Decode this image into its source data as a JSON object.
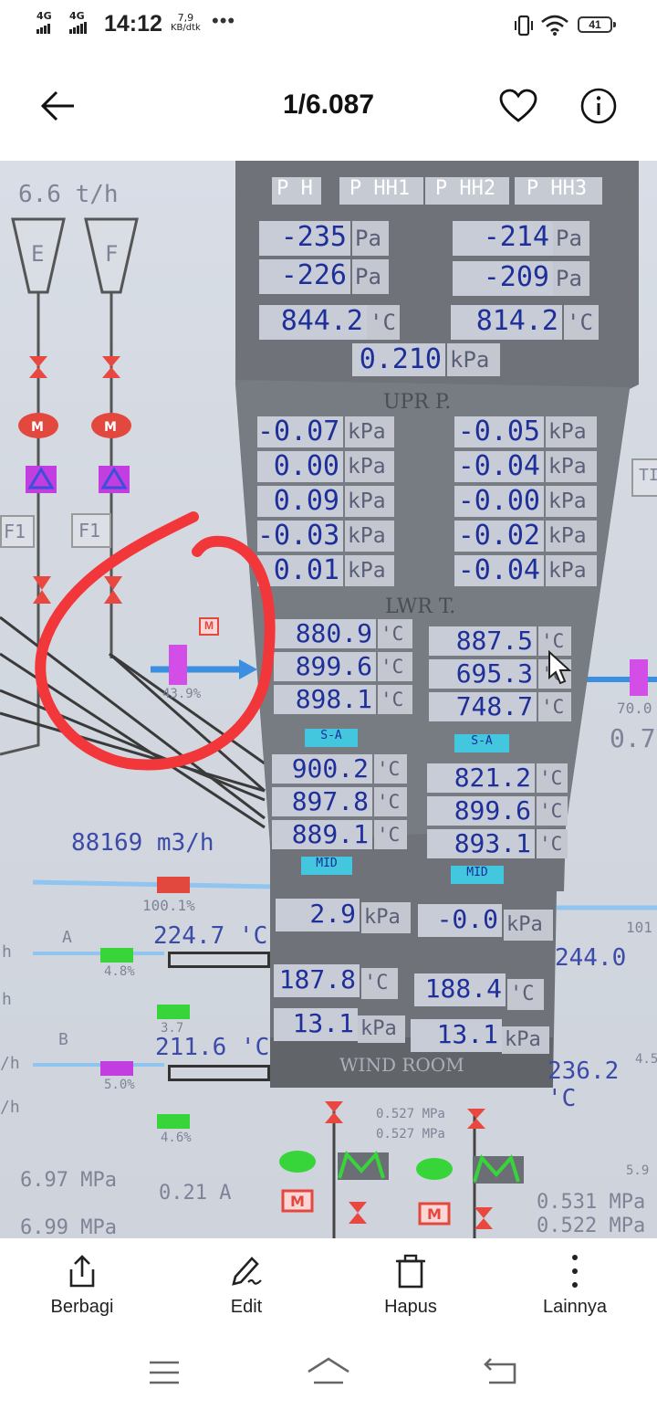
{
  "status": {
    "net1": "4G",
    "net2": "4G",
    "time": "14:12",
    "speed_value": "7,9",
    "speed_unit": "KB/dtk",
    "more": "•••",
    "battery": "41"
  },
  "header": {
    "title": "1/6.087",
    "back_icon": "arrow-left-icon",
    "favorite_icon": "heart-icon",
    "info_icon": "info-icon"
  },
  "photo": {
    "top_left_flow": "6.6 t/h",
    "hopper_e": "E",
    "hopper_f": "F",
    "feeder_1": "F1",
    "feeder_2": "F1",
    "damper_pct": "43.9%",
    "header_tabs": [
      "P H",
      "P HH1",
      "P HH2",
      "P HH3"
    ],
    "upper_pressures": [
      {
        "value": "-235",
        "unit": "Pa"
      },
      {
        "value": "-214",
        "unit": "Pa"
      },
      {
        "value": "-226",
        "unit": "Pa"
      },
      {
        "value": "-209",
        "unit": "Pa"
      }
    ],
    "upper_temps": [
      {
        "value": "844.2",
        "unit": "'C"
      },
      {
        "value": "814.2",
        "unit": "'C"
      }
    ],
    "center_pressure": {
      "value": "0.210",
      "unit": "kPa"
    },
    "upr_label": "UPR P.",
    "upr_left": [
      {
        "value": "-0.07",
        "unit": "kPa"
      },
      {
        "value": "0.00",
        "unit": "kPa"
      },
      {
        "value": "0.09",
        "unit": "kPa"
      },
      {
        "value": "-0.03",
        "unit": "kPa"
      },
      {
        "value": "0.01",
        "unit": "kPa"
      }
    ],
    "upr_right": [
      {
        "value": "-0.05",
        "unit": "kPa"
      },
      {
        "value": "-0.04",
        "unit": "kPa"
      },
      {
        "value": "-0.00",
        "unit": "kPa"
      },
      {
        "value": "-0.02",
        "unit": "kPa"
      },
      {
        "value": "-0.04",
        "unit": "kPa"
      }
    ],
    "lwr_label": "LWR T.",
    "lwr_left": [
      {
        "value": "880.9",
        "unit": "'C"
      },
      {
        "value": "899.6",
        "unit": "'C"
      },
      {
        "value": "898.1",
        "unit": "'C"
      }
    ],
    "lwr_right": [
      {
        "value": "887.5",
        "unit": "'C"
      },
      {
        "value": "695.3",
        "unit": "'C"
      },
      {
        "value": "748.7",
        "unit": "'C"
      }
    ],
    "sa_left": "S-A",
    "sa_right": "S-A",
    "mid_left_vals": [
      {
        "value": "900.2",
        "unit": "'C"
      },
      {
        "value": "897.8",
        "unit": "'C"
      },
      {
        "value": "889.1",
        "unit": "'C"
      }
    ],
    "mid_right_vals": [
      {
        "value": "821.2",
        "unit": "'C"
      },
      {
        "value": "899.6",
        "unit": "'C"
      },
      {
        "value": "893.1",
        "unit": "'C"
      }
    ],
    "mid_left": "MID",
    "mid_right": "MID",
    "air_flow": "88169 m3/h",
    "damper_main": "100.1%",
    "line_a": "A",
    "line_b": "B",
    "temp_a": "224.7 'C",
    "temp_b": "211.6 'C",
    "pct_a1": "4.8%",
    "pct_a2": "3.7",
    "pct_b1": "5.0%",
    "pct_b2": "4.6%",
    "bed_pressures": [
      {
        "value": "2.9",
        "unit": "kPa"
      },
      {
        "value": "-0.0",
        "unit": "kPa"
      }
    ],
    "wind_temps": [
      {
        "value": "187.8",
        "unit": "'C"
      },
      {
        "value": "188.4",
        "unit": "'C"
      }
    ],
    "wind_pressures": [
      {
        "value": "13.1",
        "unit": "kPa"
      },
      {
        "value": "13.1",
        "unit": "kPa"
      }
    ],
    "wind_room": "WIND ROOM",
    "right_temp1": "244.0",
    "right_temp2": "236.2 'C",
    "right_pct1": "70.0",
    "right_pct2": "101",
    "right_small": "0.7",
    "fan_mpa1": "0.527 MPa",
    "fan_mpa2": "0.527 MPa",
    "bottom_left1": "6.97 MPa",
    "bottom_left2": "0.21 A",
    "bottom_left3": "6.99 MPa",
    "bottom_right1": "0.531 MPa",
    "bottom_right2": "0.522 MPa",
    "right_edge_t": "TI",
    "right_edge_pct": "4.5",
    "right_edge_pct2": "5.9",
    "h_marks": [
      "h",
      "h",
      "/h",
      "/h"
    ]
  },
  "toolbar": {
    "share": "Berbagi",
    "edit": "Edit",
    "delete": "Hapus",
    "more": "Lainnya"
  },
  "colors": {
    "annotation": "#f2373a",
    "readout_text": "#1e2f9a",
    "cyan_tag": "#42c7df",
    "panel": "#6f7278"
  }
}
